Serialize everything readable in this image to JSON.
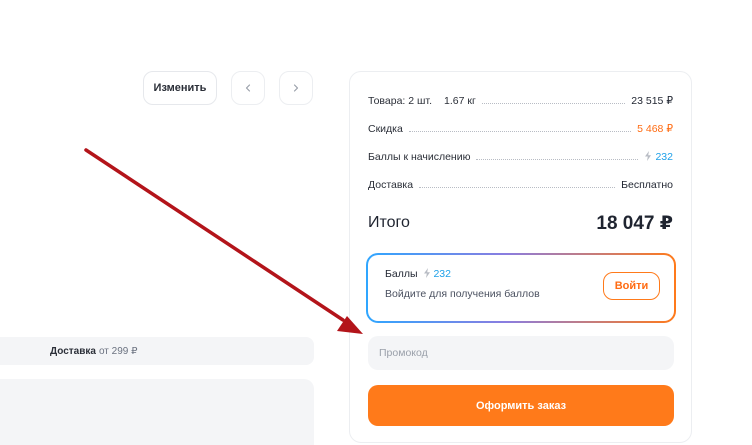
{
  "toolbar": {
    "edit_label": "Изменить",
    "prev_icon": "chevron-left-icon",
    "next_icon": "chevron-right-icon"
  },
  "delivery": {
    "label": "Доставка",
    "price": "от 299 ₽"
  },
  "summary": {
    "goods_label": "Товара: 2 шт.",
    "goods_weight": "1.67 кг",
    "goods_value": "23 515 ₽",
    "discount_label": "Скидка",
    "discount_value": "5 468 ₽",
    "points_label": "Баллы к начислению",
    "points_value": "232",
    "shipping_label": "Доставка",
    "shipping_value": "Бесплатно",
    "total_label": "Итого",
    "total_value": "18 047 ₽"
  },
  "bonus": {
    "title": "Баллы",
    "points": "232",
    "subtitle": "Войдите для получения баллов",
    "login_label": "Войти"
  },
  "promo": {
    "placeholder": "Промокод"
  },
  "order": {
    "button_label": "Оформить заказ"
  },
  "colors": {
    "accent": "#ff7a1a",
    "discount": "#ff6b12",
    "points": "#1ea0e8",
    "arrow": "#b3141a"
  }
}
